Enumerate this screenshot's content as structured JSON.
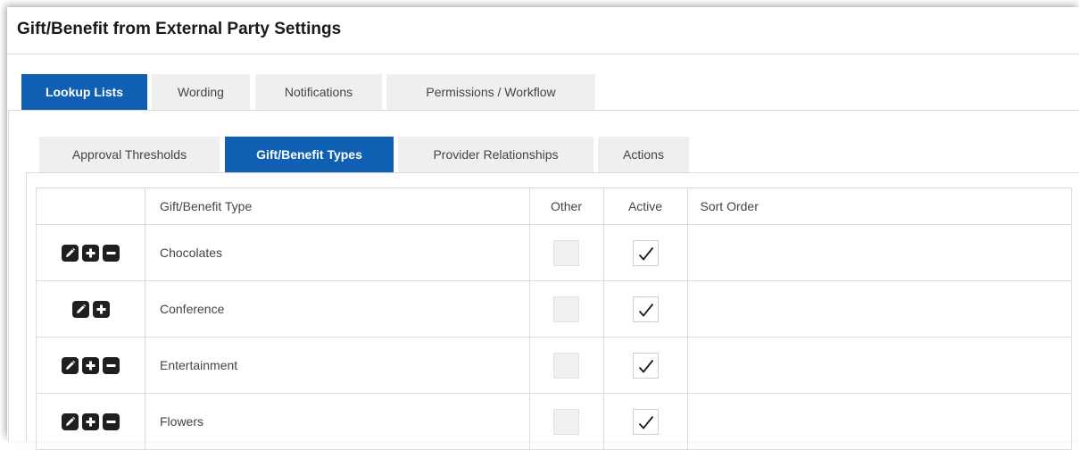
{
  "page": {
    "title": "Gift/Benefit from External Party Settings"
  },
  "main_tabs": [
    {
      "label": "Lookup Lists",
      "active": true
    },
    {
      "label": "Wording",
      "active": false
    },
    {
      "label": "Notifications",
      "active": false
    },
    {
      "label": "Permissions / Workflow",
      "active": false
    }
  ],
  "sub_tabs": [
    {
      "label": "Approval Thresholds",
      "active": false
    },
    {
      "label": "Gift/Benefit Types",
      "active": true
    },
    {
      "label": "Provider Relationships",
      "active": false
    },
    {
      "label": "Actions",
      "active": false
    }
  ],
  "table": {
    "headers": {
      "actions": "",
      "type": "Gift/Benefit Type",
      "other": "Other",
      "active": "Active",
      "sort": "Sort Order"
    },
    "rows": [
      {
        "type": "Chocolates",
        "actions": [
          "edit-icon",
          "add-icon",
          "remove-icon"
        ],
        "other": false,
        "active": true,
        "sort": ""
      },
      {
        "type": "Conference",
        "actions": [
          "edit-icon",
          "add-icon"
        ],
        "other": false,
        "active": true,
        "sort": ""
      },
      {
        "type": "Entertainment",
        "actions": [
          "edit-icon",
          "add-icon",
          "remove-icon"
        ],
        "other": false,
        "active": true,
        "sort": ""
      },
      {
        "type": "Flowers",
        "actions": [
          "edit-icon",
          "add-icon",
          "remove-icon"
        ],
        "other": false,
        "active": true,
        "sort": ""
      }
    ]
  },
  "colors": {
    "accent": "#0f5fb3",
    "tab_bg": "#efefef",
    "icon_bg": "#1f1f1f"
  }
}
